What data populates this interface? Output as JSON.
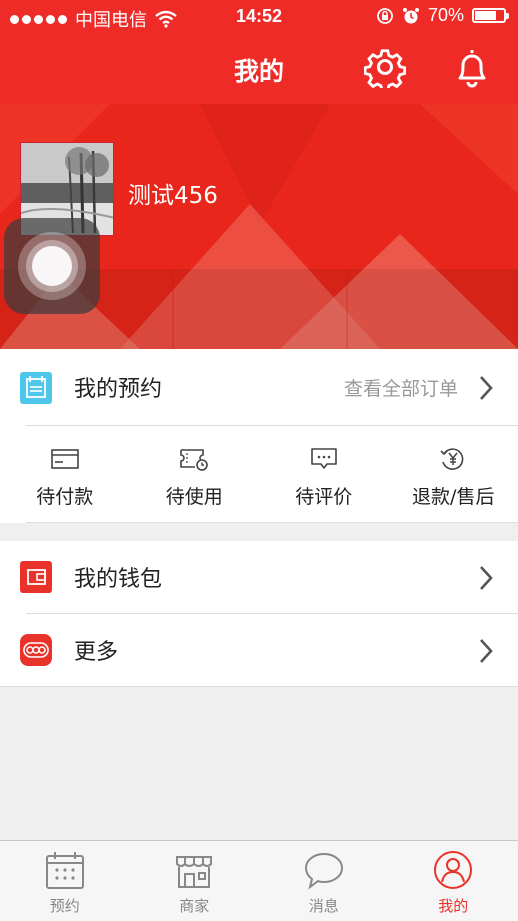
{
  "status_bar": {
    "carrier": "中国电信",
    "time": "14:52",
    "battery": "70%",
    "battery_level": 0.7
  },
  "header": {
    "title": "我的",
    "icons": [
      "gear-icon",
      "bell-icon"
    ]
  },
  "profile": {
    "username": "测试456"
  },
  "reservations": {
    "title": "我的预约",
    "view_all": "查看全部订单",
    "items": [
      {
        "label": "待付款",
        "icon": "wallet-card-icon"
      },
      {
        "label": "待使用",
        "icon": "ticket-clock-icon"
      },
      {
        "label": "待评价",
        "icon": "comment-icon"
      },
      {
        "label": "退款/售后",
        "icon": "refund-yen-icon"
      }
    ]
  },
  "menu": {
    "wallet": "我的钱包",
    "more": "更多"
  },
  "tabs": [
    {
      "label": "预约",
      "icon": "calendar-icon",
      "active": false
    },
    {
      "label": "商家",
      "icon": "shop-icon",
      "active": false
    },
    {
      "label": "消息",
      "icon": "chat-bubble-icon",
      "active": false
    },
    {
      "label": "我的",
      "icon": "person-icon",
      "active": true
    }
  ],
  "colors": {
    "brand_red": "#ef2b28",
    "active_tab": "#e8322a",
    "reservation_icon": "#4fc7ec",
    "wallet_icon": "#e8322a"
  }
}
